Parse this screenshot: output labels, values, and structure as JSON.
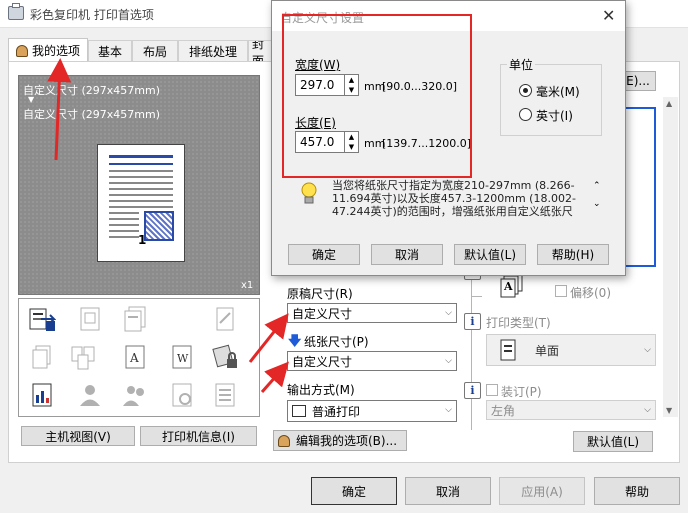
{
  "window": {
    "title": "彩色复印机 打印首选项"
  },
  "tabs": [
    "我的选项",
    "基本",
    "布局",
    "排纸处理",
    "封面"
  ],
  "preview": {
    "line1": "自定义尺寸 (297x457mm)",
    "arrow": "▼",
    "line2": "自定义尺寸 (297x457mm)",
    "page_number": "1",
    "copies": "x1"
  },
  "left_buttons": {
    "host_view": "主机视图(V)",
    "printer_info": "打印机信息(I)"
  },
  "fields": {
    "original_size_label": "原稿尺寸(R)",
    "original_size_value": "自定义尺寸",
    "paper_size_label": "纸张尺寸(P)",
    "paper_size_value": "自定义尺寸",
    "output_method_label": "输出方式(M)",
    "output_method_value": "普通打印"
  },
  "right_panel": {
    "rotate_label": "偏移(0)",
    "print_type_label": "打印类型(T)",
    "print_type_value": "单面",
    "staple_label": "装订(P)",
    "staple_value": "左角",
    "top_button_suffix": "E)...",
    "letter_a": "A"
  },
  "bottom": {
    "edit_my_options": "编辑我的选项(B)...",
    "defaults": "默认值(L)",
    "ok": "确定",
    "cancel": "取消",
    "apply": "应用(A)",
    "help": "帮助"
  },
  "dialog": {
    "title": "自定义尺寸设置",
    "width_label": "宽度(W)",
    "width_value": "297.0",
    "width_unit": "mm",
    "width_range": "[90.0...320.0]",
    "length_label": "长度(E)",
    "length_value": "457.0",
    "length_unit": "mm",
    "length_range": "[139.7...1200.0]",
    "unit_group_label": "单位",
    "unit_mm": "毫米(M)",
    "unit_inch": "英寸(I)",
    "info_text": "当您将纸张尺寸指定为宽度210-297mm (8.266-11.694英寸)以及长度457.3-1200mm (18.002-47.244英寸)的范围时，增强纸张用自定义纸张尺寸...",
    "ok": "确定",
    "cancel": "取消",
    "defaults": "默认值(L)",
    "help": "帮助(H)"
  },
  "colors": {
    "annotation_red": "#e32626",
    "window_bg": "#f0f0f0",
    "preview_bg": "#8c8c8c",
    "title_blue": "#2a4aa8"
  }
}
